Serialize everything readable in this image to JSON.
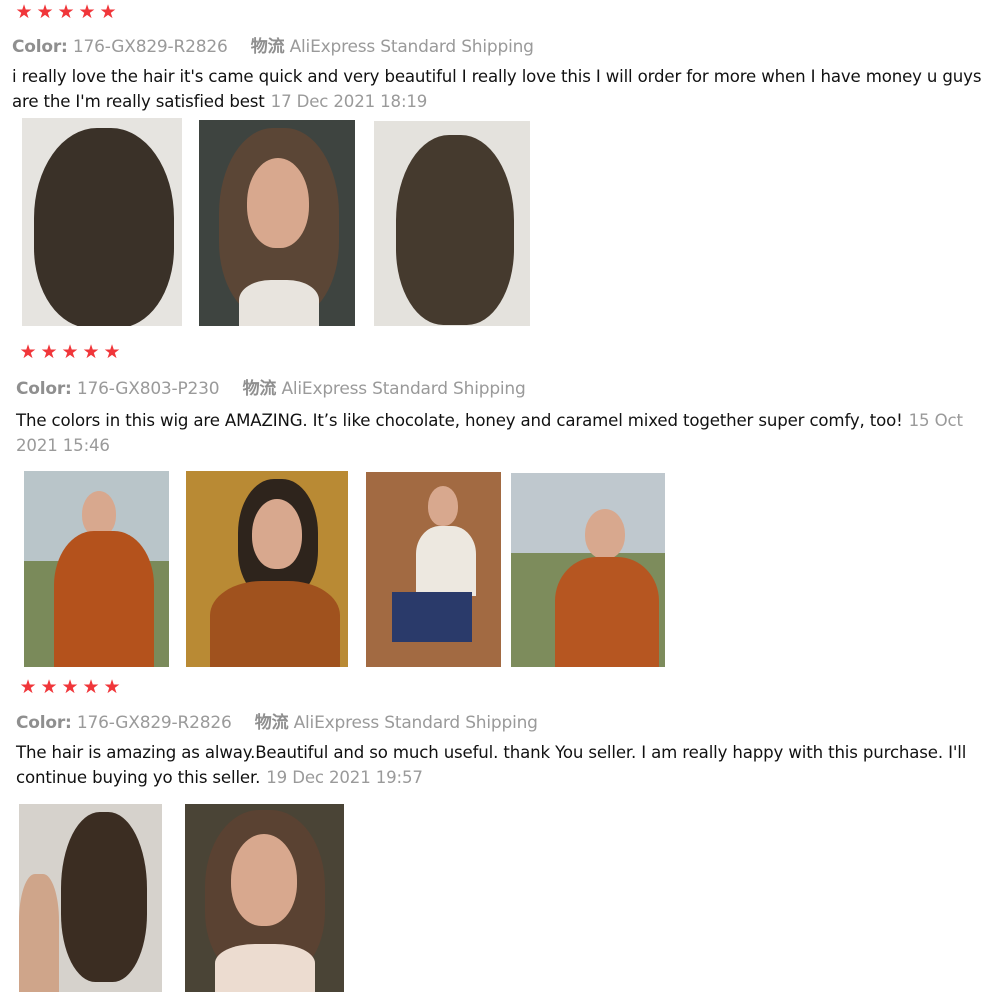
{
  "reviews": [
    {
      "rating": 5,
      "color_label": "Color:",
      "color_value": "176-GX829-R2826",
      "shipping_label": "物流",
      "shipping_value": "AliExpress Standard Shipping",
      "text": "i really love the hair it's came quick and very beautiful I really love this I will order for more when I have money u guys are the I'm really satisfied best",
      "date": "17 Dec 2021 18:19",
      "photos": [
        "wig-back-photo",
        "model-highlight-photo",
        "wig-side-photo"
      ]
    },
    {
      "rating": 5,
      "color_label": "Color:",
      "color_value": "176-GX803-P230",
      "shipping_label": "物流",
      "shipping_value": "AliExpress Standard Shipping",
      "text": "The colors in this wig are AMAZING. It’s like chocolate, honey and caramel mixed together super comfy, too!",
      "date": "15 Oct 2021 15:46",
      "photos": [
        "orange-coat-photo",
        "leopard-top-photo",
        "doorway-photo",
        "orange-coat-closeup-photo"
      ]
    },
    {
      "rating": 5,
      "color_label": "Color:",
      "color_value": "176-GX829-R2826",
      "shipping_label": "物流",
      "shipping_value": "AliExpress Standard Shipping",
      "text": "The hair is amazing as alway.Beautiful and so much useful. thank You seller. I am really happy with this purchase. I'll continue buying yo this seller.",
      "date": "19 Dec 2021 19:57",
      "photos": [
        "hand-held-wig-photo",
        "model-portrait-photo"
      ]
    }
  ],
  "icons": {
    "star": "star-icon"
  },
  "colors": {
    "star": "#f0363a",
    "meta": "#9a9a9a",
    "text": "#111111"
  }
}
